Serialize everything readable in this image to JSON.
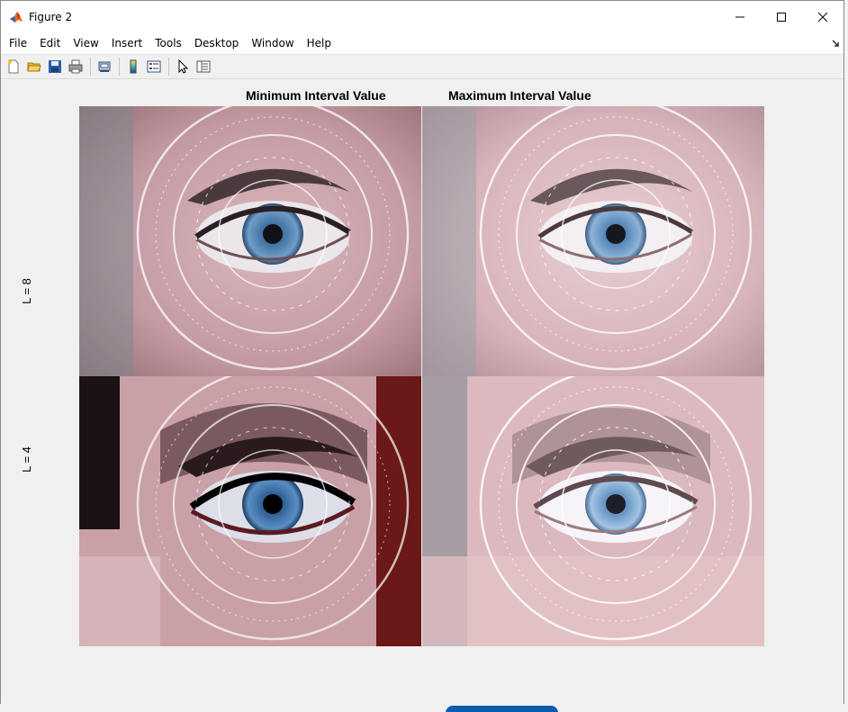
{
  "window": {
    "title": "Figure 2"
  },
  "menu": {
    "items": [
      "File",
      "Edit",
      "View",
      "Insert",
      "Tools",
      "Desktop",
      "Window",
      "Help"
    ]
  },
  "toolbar": {
    "buttons": [
      "new-figure-icon",
      "open-icon",
      "save-icon",
      "print-icon",
      "print-preview-icon",
      "colorbar-icon",
      "legend-icon",
      "pointer-icon",
      "property-inspector-icon"
    ]
  },
  "figure": {
    "col_titles": [
      "Minimum Interval Value",
      "Maximum Interval Value"
    ],
    "row_labels": [
      "L = 8",
      "L = 4"
    ],
    "panels": [
      {
        "name": "min-interval-L8",
        "tone": "normal"
      },
      {
        "name": "max-interval-L8",
        "tone": "light"
      },
      {
        "name": "min-interval-L4",
        "tone": "dark"
      },
      {
        "name": "max-interval-L4",
        "tone": "lighter"
      }
    ]
  },
  "colors": {
    "menubar_bg": "#ffffff",
    "canvas_bg": "#f0f0f0"
  }
}
